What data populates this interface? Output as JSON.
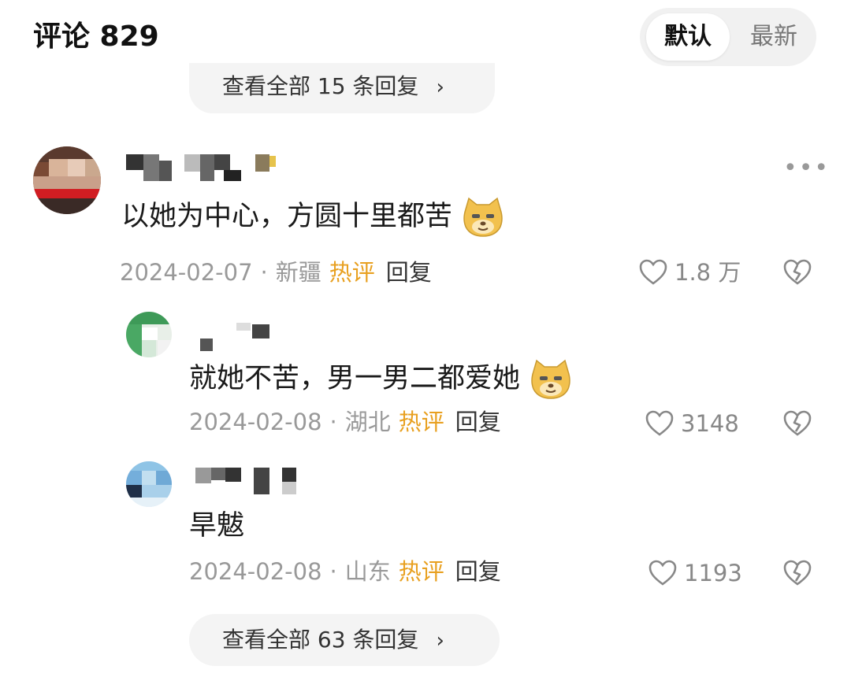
{
  "header": {
    "title": "评论 829",
    "sort_default": "默认",
    "sort_latest": "最新"
  },
  "top_expand": {
    "label": "查看全部 15 条回复",
    "chevron": "›"
  },
  "comments": [
    {
      "text": "以她为中心，方圆十里都苦",
      "date": "2024-02-07",
      "location": "新疆",
      "hot": "热评",
      "reply": "回复",
      "likes": "1.8 万",
      "more": "•••"
    },
    {
      "text": "就她不苦，男一男二都爱她",
      "date": "2024-02-08",
      "location": "湖北",
      "hot": "热评",
      "reply": "回复",
      "likes": "3148"
    },
    {
      "text": "旱魃",
      "date": "2024-02-08",
      "location": "山东",
      "hot": "热评",
      "reply": "回复",
      "likes": "1193"
    }
  ],
  "bottom_expand": {
    "label": "查看全部 63 条回复",
    "chevron": "›"
  },
  "colors": {
    "hot": "#e8a020",
    "meta": "#999999",
    "pill_bg": "#f4f4f4"
  },
  "icons": {
    "like": "heart-outline-icon",
    "dislike": "broken-heart-icon",
    "emoji": "doge-emoji-icon",
    "more": "more-dots-icon"
  }
}
